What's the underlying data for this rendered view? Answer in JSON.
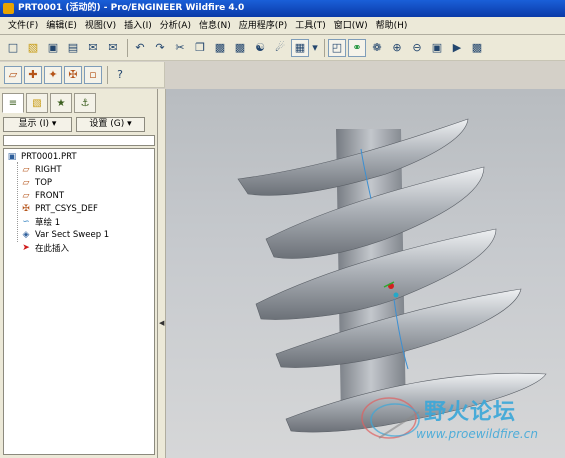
{
  "window": {
    "title": "PRT0001 (活动的) - Pro/ENGINEER Wildfire 4.0"
  },
  "menu": [
    "文件(F)",
    "编辑(E)",
    "视图(V)",
    "插入(I)",
    "分析(A)",
    "信息(N)",
    "应用程序(P)",
    "工具(T)",
    "窗口(W)",
    "帮助(H)"
  ],
  "panel": {
    "show_label": "显示 (I) ▾",
    "settings_label": "设置 (G) ▾"
  },
  "tree": {
    "root": "PRT0001.PRT",
    "items": [
      {
        "label": "RIGHT",
        "icon": "datum-plane-icon"
      },
      {
        "label": "TOP",
        "icon": "datum-plane-icon"
      },
      {
        "label": "FRONT",
        "icon": "datum-plane-icon"
      },
      {
        "label": "PRT_CSYS_DEF",
        "icon": "csys-icon"
      },
      {
        "label": "草绘 1",
        "icon": "sketch-icon"
      },
      {
        "label": "Var Sect Sweep 1",
        "icon": "sweep-icon"
      },
      {
        "label": "在此插入",
        "icon": "insert-here-icon"
      }
    ]
  },
  "watermark": {
    "text": "野火论坛",
    "url": "www.proewildfire.cn"
  },
  "colors": {
    "titlebar": "#0a3aa8",
    "surface_light": "#c9ccd0",
    "surface_dark": "#6c7178",
    "accent_edge": "#3d8fd1",
    "watermark": "#3aa7d9"
  }
}
